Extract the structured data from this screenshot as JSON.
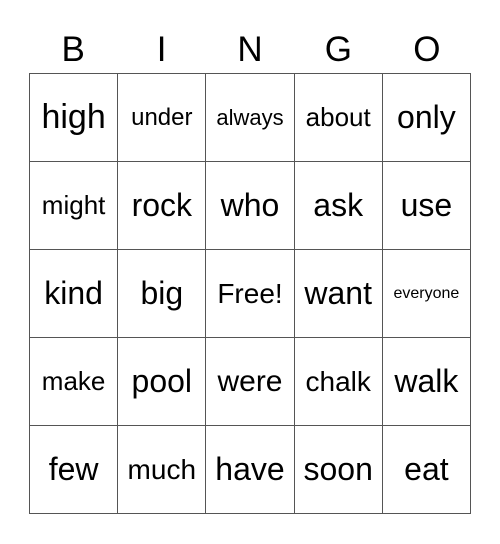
{
  "header": [
    "B",
    "I",
    "N",
    "G",
    "O"
  ],
  "cells": [
    [
      "high",
      "under",
      "always",
      "about",
      "only"
    ],
    [
      "might",
      "rock",
      "who",
      "ask",
      "use"
    ],
    [
      "kind",
      "big",
      "Free!",
      "want",
      "everyone"
    ],
    [
      "make",
      "pool",
      "were",
      "chalk",
      "walk"
    ],
    [
      "few",
      "much",
      "have",
      "soon",
      "eat"
    ]
  ]
}
